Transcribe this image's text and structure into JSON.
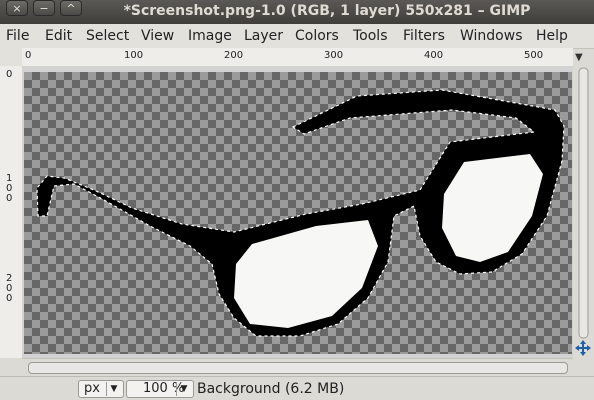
{
  "window": {
    "title": "*Screenshot.png-1.0 (RGB, 1 layer) 550x281 – GIMP",
    "buttons": [
      "×",
      "−",
      "^"
    ]
  },
  "menu": [
    "File",
    "Edit",
    "Select",
    "View",
    "Image",
    "Layer",
    "Colors",
    "Tools",
    "Filters",
    "Windows",
    "Help"
  ],
  "ruler": {
    "h_ticks": [
      "0",
      "100",
      "200",
      "300",
      "400",
      "500"
    ],
    "v_ticks": [
      "0",
      "1\n0\n0",
      "2\n0\n0"
    ]
  },
  "status": {
    "unit": "px",
    "zoom": "100 %",
    "layer_info": "Background (6.2 MB)"
  },
  "canvas": {
    "image_description": "glasses",
    "colors": {
      "frame": "#000000",
      "lens": "#f7f7f6",
      "checker_light": "#9b9b9b",
      "checker_dark": "#676767"
    }
  }
}
